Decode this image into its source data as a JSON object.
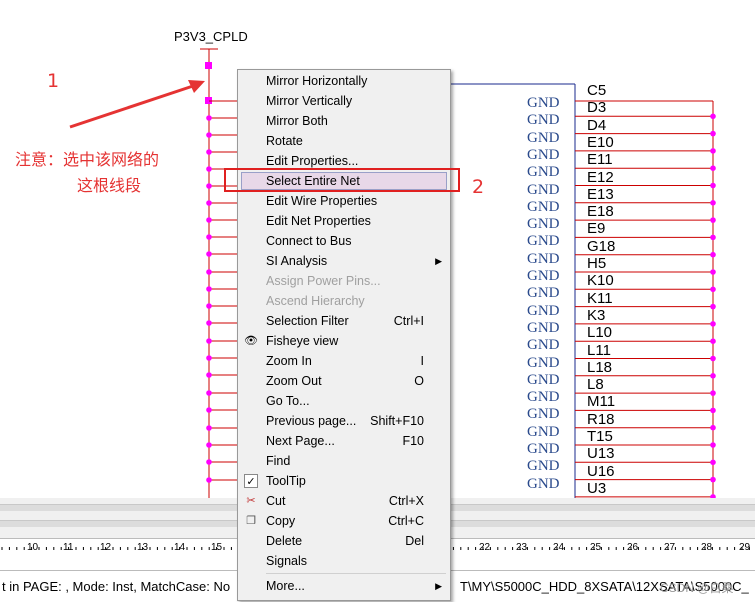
{
  "schematic": {
    "power_label": "P3V3_CPLD",
    "gnd_label": "GND",
    "pins": [
      "C5",
      "D3",
      "D4",
      "E10",
      "E11",
      "E12",
      "E13",
      "E18",
      "E9",
      "G18",
      "H5",
      "K10",
      "K11",
      "K3",
      "L10",
      "L11",
      "L18",
      "L8",
      "M11",
      "R18",
      "T15",
      "U13",
      "U16",
      "U3"
    ]
  },
  "annotations": {
    "num1": "1",
    "num2": "2",
    "note_line1": "注意：选中该网络的",
    "note_line2": "这根线段"
  },
  "context_menu": {
    "items": [
      {
        "label": "Mirror Horizontally",
        "shortcut": "",
        "state": "normal"
      },
      {
        "label": "Mirror Vertically",
        "shortcut": "",
        "state": "normal"
      },
      {
        "label": "Mirror Both",
        "shortcut": "",
        "state": "normal"
      },
      {
        "label": "Rotate",
        "shortcut": "",
        "state": "normal"
      },
      {
        "label": "Edit Properties...",
        "shortcut": "",
        "state": "normal"
      },
      {
        "label": "Select Entire Net",
        "shortcut": "",
        "state": "highlighted"
      },
      {
        "label": "Edit Wire Properties",
        "shortcut": "",
        "state": "normal"
      },
      {
        "label": "Edit Net Properties",
        "shortcut": "",
        "state": "normal"
      },
      {
        "label": "Connect to Bus",
        "shortcut": "",
        "state": "normal"
      },
      {
        "label": "SI Analysis",
        "shortcut": "",
        "state": "submenu"
      },
      {
        "label": "Assign Power Pins...",
        "shortcut": "",
        "state": "disabled"
      },
      {
        "label": "Ascend Hierarchy",
        "shortcut": "",
        "state": "disabled"
      },
      {
        "label": "Selection Filter",
        "shortcut": "Ctrl+I",
        "state": "normal"
      },
      {
        "label": "Fisheye view",
        "shortcut": "",
        "state": "icon-eye"
      },
      {
        "label": "Zoom In",
        "shortcut": "I",
        "state": "normal"
      },
      {
        "label": "Zoom Out",
        "shortcut": "O",
        "state": "normal"
      },
      {
        "label": "Go To...",
        "shortcut": "",
        "state": "normal"
      },
      {
        "label": "Previous page...",
        "shortcut": "Shift+F10",
        "state": "normal"
      },
      {
        "label": "Next Page...",
        "shortcut": "F10",
        "state": "normal"
      },
      {
        "label": "Find",
        "shortcut": "",
        "state": "normal"
      },
      {
        "label": "ToolTip",
        "shortcut": "",
        "state": "checked"
      },
      {
        "label": "Cut",
        "shortcut": "Ctrl+X",
        "state": "icon-cut"
      },
      {
        "label": "Copy",
        "shortcut": "Ctrl+C",
        "state": "icon-copy"
      },
      {
        "label": "Delete",
        "shortcut": "Del",
        "state": "normal"
      },
      {
        "label": "Signals",
        "shortcut": "",
        "state": "normal"
      },
      {
        "label": "More...",
        "shortcut": "",
        "state": "submenu"
      }
    ]
  },
  "ruler": {
    "left_labels": [
      "10",
      "11",
      "12",
      "13",
      "14",
      "15"
    ],
    "right_labels": [
      "22",
      "23",
      "24",
      "25",
      "26",
      "27",
      "28",
      "29"
    ]
  },
  "status": {
    "left": "t in PAGE: , Mode: Inst, MatchCase: No",
    "right": "T\\MY\\S5000C_HDD_8XSATA\\12XSATA\\S5000C_",
    "watermark": "CSDN @白桑"
  },
  "colors": {
    "wire": "#cc0000",
    "pin_dot": "#ff00ff",
    "annotation": "#e53333",
    "gnd_text": "#2a4a8c"
  }
}
